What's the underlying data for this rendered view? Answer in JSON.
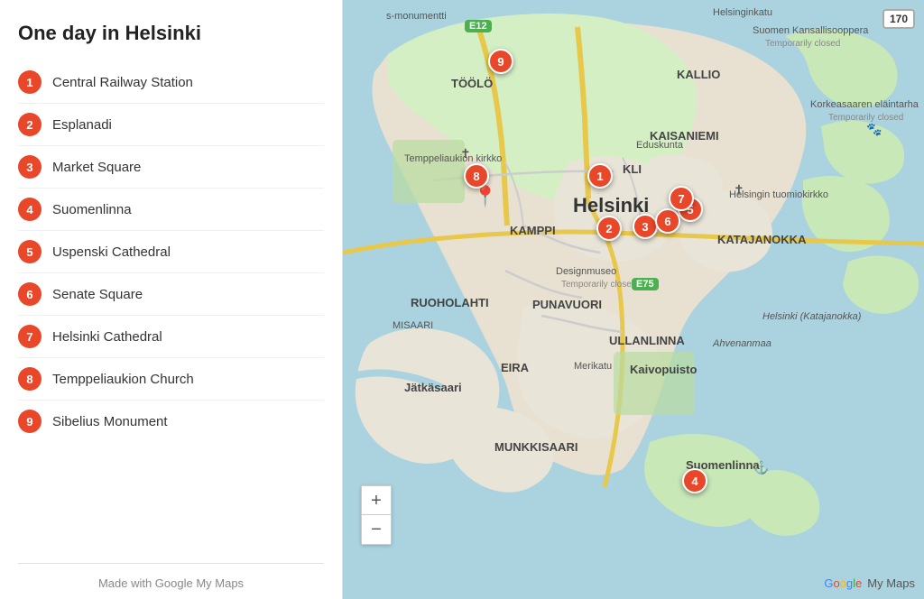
{
  "sidebar": {
    "title": "One day in Helsinki",
    "footer": "Made with Google My Maps"
  },
  "locations": [
    {
      "id": 1,
      "name": "Central Railway Station"
    },
    {
      "id": 2,
      "name": "Esplanadi"
    },
    {
      "id": 3,
      "name": "Market Square"
    },
    {
      "id": 4,
      "name": "Suomenlinna"
    },
    {
      "id": 5,
      "name": "Uspenski Cathedral"
    },
    {
      "id": 6,
      "name": "Senate Square"
    },
    {
      "id": 7,
      "name": "Helsinki Cathedral"
    },
    {
      "id": 8,
      "name": "Temppeliaukion Church"
    },
    {
      "id": 9,
      "name": "Sibelius Monument"
    }
  ],
  "markers": [
    {
      "id": 1,
      "left": "285",
      "top": "195"
    },
    {
      "id": 2,
      "left": "295",
      "top": "253"
    },
    {
      "id": 3,
      "left": "335",
      "top": "251"
    },
    {
      "id": 4,
      "left": "390",
      "top": "533"
    },
    {
      "id": 5,
      "left": "385",
      "top": "232"
    },
    {
      "id": 6,
      "left": "360",
      "top": "245"
    },
    {
      "id": 7,
      "left": "375",
      "top": "220"
    },
    {
      "id": 8,
      "left": "148",
      "top": "195"
    },
    {
      "id": 9,
      "left": "175",
      "top": "68"
    }
  ],
  "mapLabels": [
    {
      "text": "Helsinki",
      "left": "255",
      "top": "222",
      "class": "large"
    },
    {
      "text": "TÖÖLÖ",
      "left": "155",
      "top": "90",
      "class": "medium"
    },
    {
      "text": "KALLIO",
      "left": "375",
      "top": "85",
      "class": "medium"
    },
    {
      "text": "KAMPPI",
      "left": "185",
      "top": "248",
      "class": "medium"
    },
    {
      "text": "KAISANIEMI",
      "left": "365",
      "top": "148",
      "class": "medium"
    },
    {
      "text": "KLI",
      "left": "315",
      "top": "182",
      "class": "small"
    },
    {
      "text": "KATAJANOKKA",
      "left": "430",
      "top": "260",
      "class": "medium"
    },
    {
      "text": "RUOHOLAHTI",
      "left": "95",
      "top": "335",
      "class": "medium"
    },
    {
      "text": "MISAARI",
      "left": "65",
      "top": "360",
      "class": "small"
    },
    {
      "text": "PUNAVUORI",
      "left": "230",
      "top": "335",
      "class": "medium"
    },
    {
      "text": "ULLANLINNA",
      "left": "310",
      "top": "370",
      "class": "medium"
    },
    {
      "text": "EIRA",
      "left": "190",
      "top": "405",
      "class": "medium"
    },
    {
      "text": "Jätkäsaari",
      "left": "80",
      "top": "430",
      "class": "medium"
    },
    {
      "text": "MUNKKISAARI",
      "left": "195",
      "top": "490",
      "class": "medium"
    },
    {
      "text": "Kaivopuisto",
      "left": "335",
      "top": "408",
      "class": "medium"
    },
    {
      "text": "Merikatu",
      "left": "265",
      "top": "405",
      "class": "small"
    },
    {
      "text": "Suomenlinna",
      "left": "410",
      "top": "512",
      "class": "medium"
    },
    {
      "text": "Helsingin tuomiokirkko",
      "left": "450",
      "top": "215",
      "class": "small"
    },
    {
      "text": "Suomen Kansallisooppera",
      "left": "490",
      "top": "32",
      "class": "small"
    },
    {
      "text": "Temporarily closed",
      "left": "490",
      "top": "46",
      "class": "sub"
    },
    {
      "text": "Korkeasaaren eläintarha",
      "left": "545",
      "top": "115",
      "class": "small"
    },
    {
      "text": "Temporarily closed",
      "left": "545",
      "top": "129",
      "class": "sub"
    },
    {
      "text": "Temppeliaukion kirkko",
      "left": "95",
      "top": "175",
      "class": "small"
    },
    {
      "text": "Eduskunta",
      "left": "340",
      "top": "158",
      "class": "small"
    },
    {
      "text": "Designmuseo",
      "left": "260",
      "top": "298",
      "class": "small"
    },
    {
      "text": "Temporarily closed",
      "left": "260",
      "top": "312",
      "class": "sub"
    },
    {
      "text": "Helsinginkatu",
      "left": "430",
      "top": "10",
      "class": "small"
    },
    {
      "text": "s-monumentti",
      "left": "75",
      "top": "16",
      "class": "small"
    }
  ],
  "attribution": {
    "text": "Google My Maps"
  },
  "zoom": {
    "plus": "+",
    "minus": "−"
  },
  "roads": {
    "e12": "E12",
    "e75": "E75",
    "r170": "170"
  }
}
